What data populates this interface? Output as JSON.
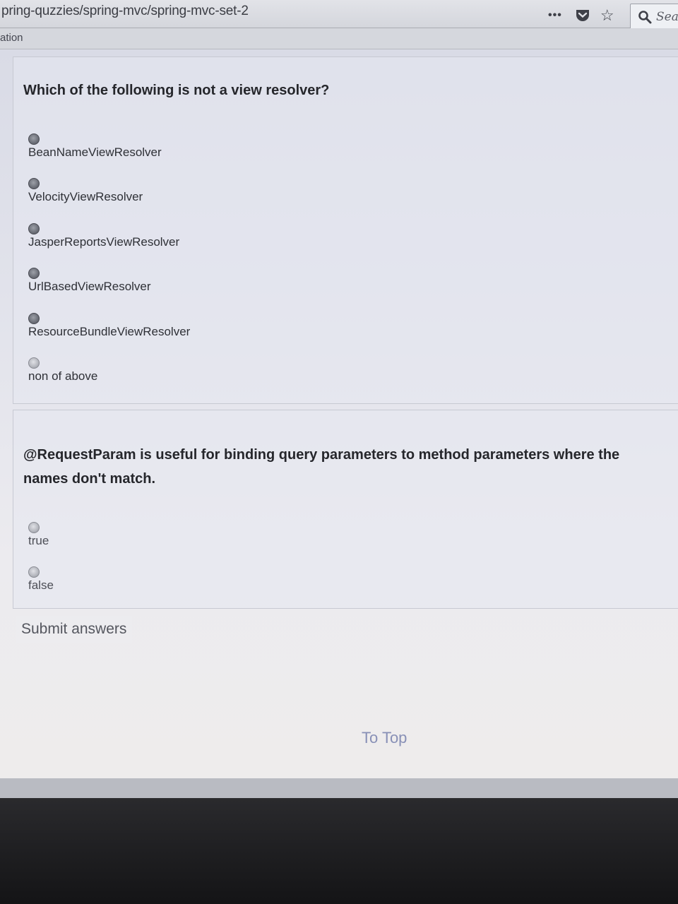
{
  "browser": {
    "url": "pring-quzzies/spring-mvc/spring-mvc-set-2",
    "menu_icon": "page-actions-icon",
    "pocket_icon": "pocket-icon",
    "bookmark_icon": "star-icon",
    "search_placeholder": "Sea",
    "bookmark_label": "ation"
  },
  "quiz": {
    "questions": [
      {
        "text": "Which of the following is not a view resolver?",
        "options": [
          "BeanNameViewResolver",
          "VelocityViewResolver",
          "JasperReportsViewResolver",
          "UrlBasedViewResolver",
          "ResourceBundleViewResolver",
          "non of above"
        ]
      },
      {
        "text": "@RequestParam is useful for binding query parameters to method parameters where the names don't match.",
        "options": [
          "true",
          "false"
        ]
      }
    ],
    "submit_label": "Submit answers",
    "to_top_label": "To Top"
  },
  "colors": {
    "page_background": "#e3e4ec",
    "link": "#8890b6"
  }
}
